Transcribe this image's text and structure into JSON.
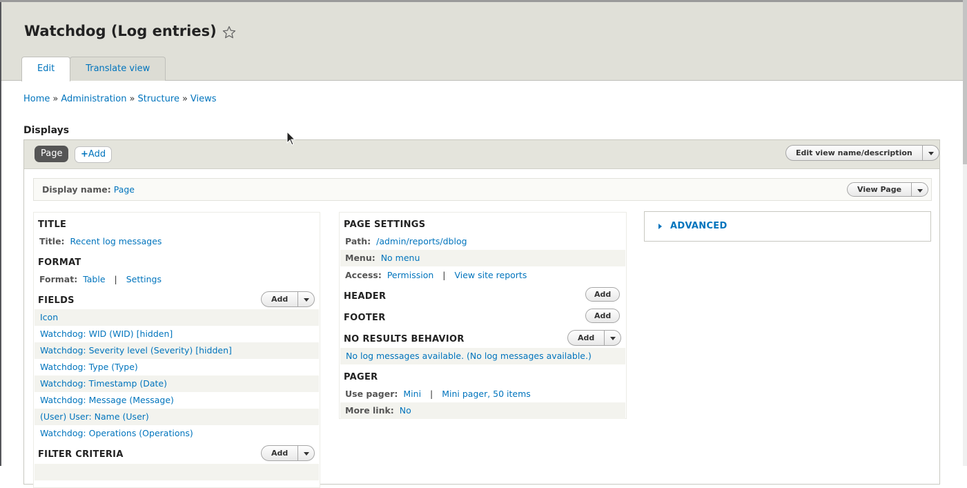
{
  "page": {
    "title": "Watchdog (Log entries)",
    "tabs": [
      {
        "label": "Edit",
        "active": true
      },
      {
        "label": "Translate view",
        "active": false
      }
    ]
  },
  "breadcrumb": [
    "Home",
    "Administration",
    "Structure",
    "Views"
  ],
  "breadcrumb_separator": "»",
  "displays": {
    "heading": "Displays",
    "page_pill": "Page",
    "add_label": "Add",
    "edit_view_label": "Edit view name/description",
    "display_name_label": "Display name:",
    "display_name_value": "Page",
    "view_page_label": "View Page"
  },
  "left_column": {
    "title_section": {
      "heading": "TITLE",
      "label": "Title:",
      "value": "Recent log messages"
    },
    "format_section": {
      "heading": "FORMAT",
      "label": "Format:",
      "value": "Table",
      "settings": "Settings"
    },
    "fields_section": {
      "heading": "FIELDS",
      "add_label": "Add",
      "items": [
        "Icon",
        "Watchdog: WID (WID) [hidden]",
        "Watchdog: Severity level (Severity) [hidden]",
        "Watchdog: Type (Type)",
        "Watchdog: Timestamp (Date)",
        "Watchdog: Message (Message)",
        "(User) User: Name (User)",
        "Watchdog: Operations (Operations)"
      ]
    },
    "filter_section": {
      "heading": "FILTER CRITERIA",
      "add_label": "Add"
    }
  },
  "middle_column": {
    "page_settings": {
      "heading": "PAGE SETTINGS",
      "path_label": "Path:",
      "path_value": "/admin/reports/dblog",
      "menu_label": "Menu:",
      "menu_value": "No menu",
      "access_label": "Access:",
      "access_value": "Permission",
      "access_extra": "View site reports"
    },
    "header": {
      "heading": "HEADER",
      "add_label": "Add"
    },
    "footer": {
      "heading": "FOOTER",
      "add_label": "Add"
    },
    "no_results": {
      "heading": "NO RESULTS BEHAVIOR",
      "add_label": "Add",
      "item": "No log messages available. (No log messages available.)"
    },
    "pager": {
      "heading": "PAGER",
      "use_label": "Use pager:",
      "use_value": "Mini",
      "use_extra": "Mini pager, 50 items",
      "more_label": "More link:",
      "more_value": "No"
    }
  },
  "advanced": {
    "label": "ADVANCED"
  },
  "separators": {
    "pipe": "|"
  },
  "colors": {
    "link": "#0074bd",
    "header_bg": "#e0e0d8",
    "pill_dark": "#555555"
  }
}
